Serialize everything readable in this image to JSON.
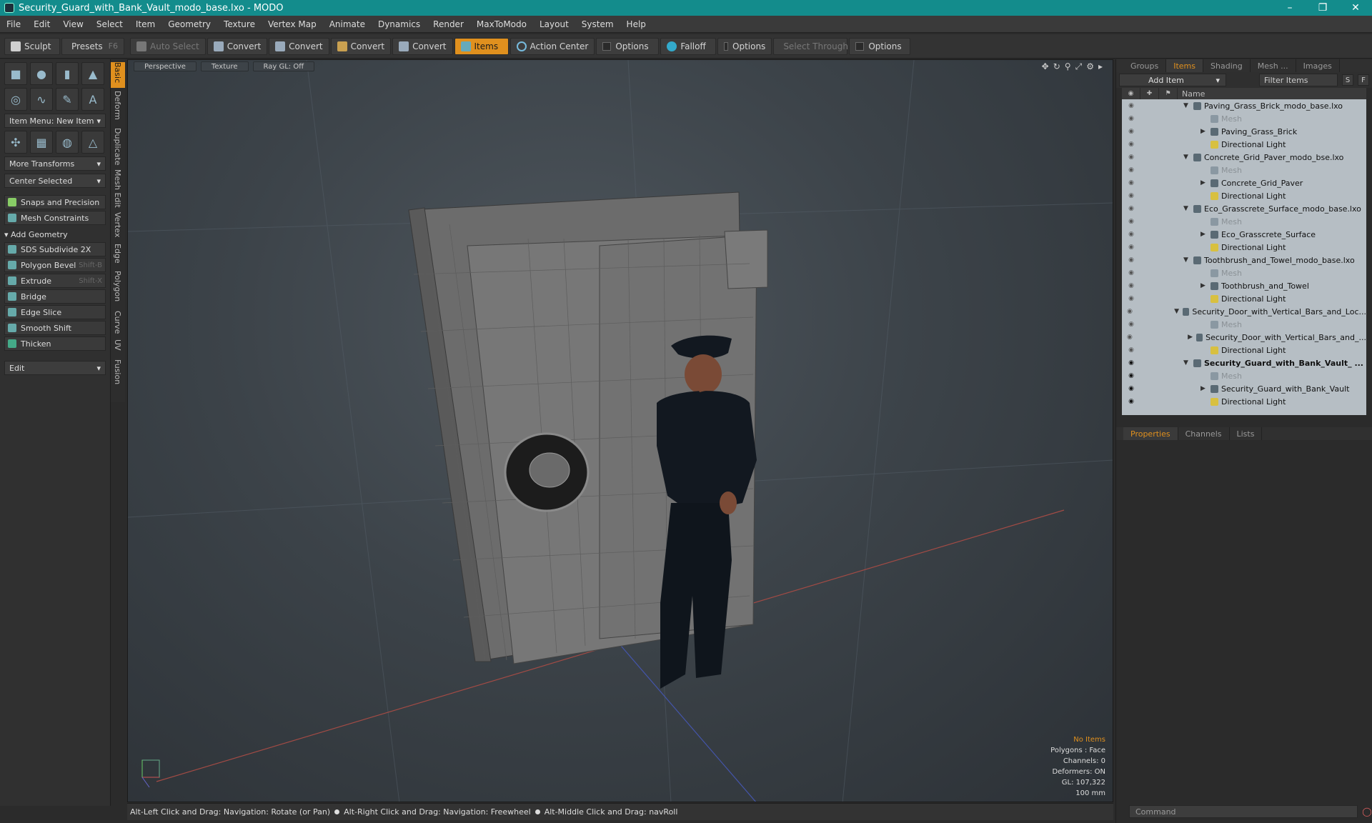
{
  "title_bar": {
    "title": "Security_Guard_with_Bank_Vault_modo_base.lxo - MODO",
    "minimize": "–",
    "restore": "❐",
    "close": "✕"
  },
  "menu": [
    "File",
    "Edit",
    "View",
    "Select",
    "Item",
    "Geometry",
    "Texture",
    "Vertex Map",
    "Animate",
    "Dynamics",
    "Render",
    "MaxToModo",
    "Layout",
    "System",
    "Help"
  ],
  "toolbar": {
    "sculpt": "Sculpt",
    "presets": "Presets",
    "presets_shortcut": "F6",
    "auto_select": "Auto Select",
    "convert1": "Convert",
    "convert2": "Convert",
    "convert3": "Convert",
    "convert4": "Convert",
    "items": "Items",
    "action_center": "Action Center",
    "options1": "Options",
    "falloff": "Falloff",
    "options2": "Options",
    "select_through": "Select Through",
    "options3": "Options"
  },
  "left_panel": {
    "item_menu": "Item Menu: New Item",
    "more_transforms": "More Transforms",
    "center_selected": "Center Selected",
    "snaps": "Snaps and Precision",
    "mesh_constraints": "Mesh Constraints",
    "add_geometry": "Add Geometry",
    "tools": [
      {
        "label": "SDS Subdivide 2X",
        "shortcut": ""
      },
      {
        "label": "Polygon Bevel",
        "shortcut": "Shift-B"
      },
      {
        "label": "Extrude",
        "shortcut": "Shift-X"
      },
      {
        "label": "Bridge",
        "shortcut": ""
      },
      {
        "label": "Edge Slice",
        "shortcut": ""
      },
      {
        "label": "Smooth Shift",
        "shortcut": ""
      },
      {
        "label": "Thicken",
        "shortcut": ""
      }
    ],
    "edit_dropdown": "Edit"
  },
  "vertical_tabs": [
    "Basic",
    "Deform",
    "Duplicate",
    "Mesh Edit",
    "Vertex",
    "Edge",
    "Polygon",
    "Curve",
    "UV",
    "Fusion"
  ],
  "viewport": {
    "perspective": "Perspective",
    "texture": "Texture",
    "raygl": "Ray GL: Off",
    "info": {
      "no_items": "No Items",
      "polygons": "Polygons : Face",
      "channels": "Channels: 0",
      "deformers": "Deformers: ON",
      "gl": "GL: 107,322",
      "scale": "100 mm"
    }
  },
  "status_bar": {
    "hint1": "Alt-Left Click and Drag: Navigation: Rotate (or Pan)",
    "hint2": "Alt-Right Click and Drag: Navigation: Freewheel",
    "hint3": "Alt-Middle Click and Drag: navRoll"
  },
  "right_panel": {
    "tabs": [
      "Groups",
      "Items",
      "Shading",
      "Mesh ...",
      "Images"
    ],
    "add_item": "Add Item",
    "filter_items": "Filter Items",
    "s_button": "S",
    "f_button": "F",
    "name_header": "Name",
    "tree": [
      {
        "label": "Paving_Grass_Brick_modo_base.lxo",
        "kind": "scene"
      },
      {
        "label": "Mesh",
        "kind": "mesh"
      },
      {
        "label": "Paving_Grass_Brick",
        "kind": "group"
      },
      {
        "label": "Directional Light",
        "kind": "light"
      },
      {
        "label": "Concrete_Grid_Paver_modo_bse.lxo",
        "kind": "scene"
      },
      {
        "label": "Mesh",
        "kind": "mesh"
      },
      {
        "label": "Concrete_Grid_Paver",
        "kind": "group"
      },
      {
        "label": "Directional Light",
        "kind": "light"
      },
      {
        "label": "Eco_Grasscrete_Surface_modo_base.lxo",
        "kind": "scene"
      },
      {
        "label": "Mesh",
        "kind": "mesh"
      },
      {
        "label": "Eco_Grasscrete_Surface",
        "kind": "group"
      },
      {
        "label": "Directional Light",
        "kind": "light"
      },
      {
        "label": "Toothbrush_and_Towel_modo_base.lxo",
        "kind": "scene"
      },
      {
        "label": "Mesh",
        "kind": "mesh"
      },
      {
        "label": "Toothbrush_and_Towel",
        "kind": "group"
      },
      {
        "label": "Directional Light",
        "kind": "light"
      },
      {
        "label": "Security_Door_with_Vertical_Bars_and_Loc...",
        "kind": "scene"
      },
      {
        "label": "Mesh",
        "kind": "mesh"
      },
      {
        "label": "Security_Door_with_Vertical_Bars_and_...",
        "kind": "group"
      },
      {
        "label": "Directional Light",
        "kind": "light"
      },
      {
        "label": "Security_Guard_with_Bank_Vault_ ...",
        "kind": "scene-active"
      },
      {
        "label": "Mesh",
        "kind": "mesh"
      },
      {
        "label": "Security_Guard_with_Bank_Vault",
        "kind": "group"
      },
      {
        "label": "Directional Light",
        "kind": "light"
      }
    ],
    "bottom_tabs": [
      "Properties",
      "Channels",
      "Lists"
    ],
    "command_placeholder": "Command"
  },
  "colors": {
    "accent": "#e0901e",
    "titlebar": "#138c8c"
  }
}
